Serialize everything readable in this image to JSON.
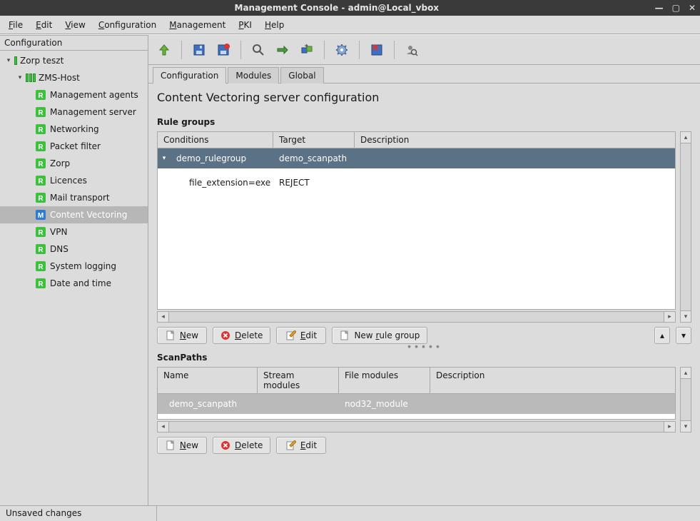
{
  "window": {
    "title": "Management Console - admin@Local_vbox"
  },
  "menu": {
    "items": [
      "File",
      "Edit",
      "View",
      "Configuration",
      "Management",
      "PKI",
      "Help"
    ]
  },
  "sidebar": {
    "header": "Configuration",
    "root": {
      "label": "Zorp teszt"
    },
    "host": {
      "label": "ZMS-Host"
    },
    "items": [
      {
        "label": "Management agents",
        "badge": "R"
      },
      {
        "label": "Management server",
        "badge": "R"
      },
      {
        "label": "Networking",
        "badge": "R"
      },
      {
        "label": "Packet filter",
        "badge": "R"
      },
      {
        "label": "Zorp",
        "badge": "R"
      },
      {
        "label": "Licences",
        "badge": "R"
      },
      {
        "label": "Mail transport",
        "badge": "R"
      },
      {
        "label": "Content Vectoring",
        "badge": "M",
        "selected": true
      },
      {
        "label": "VPN",
        "badge": "R"
      },
      {
        "label": "DNS",
        "badge": "R"
      },
      {
        "label": "System logging",
        "badge": "R"
      },
      {
        "label": "Date and time",
        "badge": "R"
      }
    ]
  },
  "tabs": {
    "items": [
      "Configuration",
      "Modules",
      "Global"
    ],
    "active": 0
  },
  "page": {
    "title": "Content Vectoring server configuration"
  },
  "rulegroups": {
    "section_label": "Rule groups",
    "columns": [
      "Conditions",
      "Target",
      "Description"
    ],
    "group": {
      "conditions": "demo_rulegroup",
      "target": "demo_scanpath",
      "description": ""
    },
    "child": {
      "conditions": "file_extension=exe",
      "target": "REJECT",
      "description": ""
    },
    "buttons": {
      "new": "New",
      "delete": "Delete",
      "edit": "Edit",
      "newgroup_prefix": "New ",
      "newgroup_ul": "r",
      "newgroup_suffix": "ule group"
    }
  },
  "scanpaths": {
    "section_label": "ScanPaths",
    "columns": [
      "Name",
      "Stream modules",
      "File modules",
      "Description"
    ],
    "row": {
      "name": "demo_scanpath",
      "stream": "",
      "file": "nod32_module",
      "description": ""
    },
    "buttons": {
      "new": "New",
      "delete": "Delete",
      "edit": "Edit"
    }
  },
  "status": {
    "left": "Unsaved changes",
    "right": ""
  }
}
